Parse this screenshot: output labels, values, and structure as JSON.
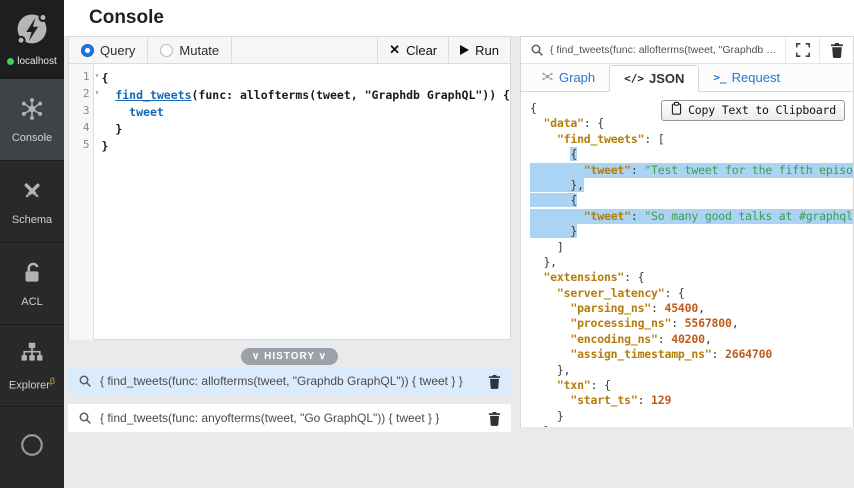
{
  "header": {
    "title": "Console"
  },
  "sidebar": {
    "connection": {
      "label": "localhost"
    },
    "items": [
      {
        "label": "Console"
      },
      {
        "label": "Schema"
      },
      {
        "label": "ACL"
      },
      {
        "label": "Explorer",
        "beta": "β"
      }
    ]
  },
  "editor_panel": {
    "tabs": {
      "query": "Query",
      "mutate": "Mutate"
    },
    "actions": {
      "clear": "Clear",
      "run": "Run"
    },
    "lines": [
      {
        "fold": true,
        "segs": [
          {
            "t": "{",
            "c": "p"
          }
        ]
      },
      {
        "fold": true,
        "segs": [
          {
            "t": "  ",
            "c": "p"
          },
          {
            "t": "find_tweets",
            "c": "kwu"
          },
          {
            "t": "(func: allofterms(tweet, \"Graphdb GraphQL\")) {",
            "c": "p"
          }
        ]
      },
      {
        "segs": [
          {
            "t": "    ",
            "c": "p"
          },
          {
            "t": "tweet",
            "c": "kw"
          }
        ]
      },
      {
        "segs": [
          {
            "t": "  }",
            "c": "p"
          }
        ]
      },
      {
        "segs": [
          {
            "t": "}",
            "c": "p"
          }
        ]
      }
    ]
  },
  "history": {
    "pill": "∨ HISTORY ∨",
    "items": [
      {
        "query": "{ find_tweets(func: allofterms(tweet, \"Graphdb GraphQL\")) { tweet } }"
      },
      {
        "query": "{ find_tweets(func: anyofterms(tweet, \"Go GraphQL\")) { tweet } }"
      }
    ]
  },
  "result_panel": {
    "query_preview": "{ find_tweets(func: allofterms(tweet, \"Graphdb GraphQL\")) { tweet } }",
    "tabs": [
      {
        "label": "Graph"
      },
      {
        "label": "JSON",
        "active": true
      },
      {
        "label": "Request"
      }
    ],
    "tab_glyphs": {
      "json": "</>",
      "request": ">_"
    },
    "copy_button": "Copy Text to Clipboard",
    "json_lines": [
      {
        "segs": [
          {
            "t": "{",
            "c": "p"
          }
        ]
      },
      {
        "segs": [
          {
            "t": "  ",
            "c": "p"
          },
          {
            "t": "\"data\"",
            "c": "k"
          },
          {
            "t": ": {",
            "c": "p"
          }
        ]
      },
      {
        "segs": [
          {
            "t": "    ",
            "c": "p"
          },
          {
            "t": "\"find_tweets\"",
            "c": "k"
          },
          {
            "t": ": [",
            "c": "p"
          }
        ]
      },
      {
        "segs": [
          {
            "t": "      ",
            "c": "p"
          },
          {
            "t": "{",
            "c": "p",
            "sel": true
          }
        ]
      },
      {
        "full_sel": true,
        "segs": [
          {
            "t": "        ",
            "c": "p"
          },
          {
            "t": "\"tweet\"",
            "c": "k"
          },
          {
            "t": ": ",
            "c": "p"
          },
          {
            "t": "\"Test tweet for the fifth episode of",
            "c": "s"
          }
        ]
      },
      {
        "segs": [
          {
            "t": "      },",
            "c": "p",
            "sel": true
          }
        ]
      },
      {
        "segs": [
          {
            "t": "      {",
            "c": "p",
            "sel": true
          }
        ]
      },
      {
        "full_sel": true,
        "segs": [
          {
            "t": "        ",
            "c": "p"
          },
          {
            "t": "\"tweet\"",
            "c": "k"
          },
          {
            "t": ": ",
            "c": "p"
          },
          {
            "t": "\"So many good talks at #graphqlconf,",
            "c": "s"
          }
        ]
      },
      {
        "segs": [
          {
            "t": "      }",
            "c": "p",
            "sel": true
          }
        ]
      },
      {
        "segs": [
          {
            "t": "    ]",
            "c": "p"
          }
        ]
      },
      {
        "segs": [
          {
            "t": "  },",
            "c": "p"
          }
        ]
      },
      {
        "segs": [
          {
            "t": "  ",
            "c": "p"
          },
          {
            "t": "\"extensions\"",
            "c": "k"
          },
          {
            "t": ": {",
            "c": "p"
          }
        ]
      },
      {
        "segs": [
          {
            "t": "    ",
            "c": "p"
          },
          {
            "t": "\"server_latency\"",
            "c": "k"
          },
          {
            "t": ": {",
            "c": "p"
          }
        ]
      },
      {
        "segs": [
          {
            "t": "      ",
            "c": "p"
          },
          {
            "t": "\"parsing_ns\"",
            "c": "k"
          },
          {
            "t": ": ",
            "c": "p"
          },
          {
            "t": "45400",
            "c": "n"
          },
          {
            "t": ",",
            "c": "p"
          }
        ]
      },
      {
        "segs": [
          {
            "t": "      ",
            "c": "p"
          },
          {
            "t": "\"processing_ns\"",
            "c": "k"
          },
          {
            "t": ": ",
            "c": "p"
          },
          {
            "t": "5567800",
            "c": "n"
          },
          {
            "t": ",",
            "c": "p"
          }
        ]
      },
      {
        "segs": [
          {
            "t": "      ",
            "c": "p"
          },
          {
            "t": "\"encoding_ns\"",
            "c": "k"
          },
          {
            "t": ": ",
            "c": "p"
          },
          {
            "t": "40200",
            "c": "n"
          },
          {
            "t": ",",
            "c": "p"
          }
        ]
      },
      {
        "segs": [
          {
            "t": "      ",
            "c": "p"
          },
          {
            "t": "\"assign_timestamp_ns\"",
            "c": "k"
          },
          {
            "t": ": ",
            "c": "p"
          },
          {
            "t": "2664700",
            "c": "n"
          }
        ]
      },
      {
        "segs": [
          {
            "t": "    },",
            "c": "p"
          }
        ]
      },
      {
        "segs": [
          {
            "t": "    ",
            "c": "p"
          },
          {
            "t": "\"txn\"",
            "c": "k"
          },
          {
            "t": ": {",
            "c": "p"
          }
        ]
      },
      {
        "segs": [
          {
            "t": "      ",
            "c": "p"
          },
          {
            "t": "\"start_ts\"",
            "c": "k"
          },
          {
            "t": ": ",
            "c": "p"
          },
          {
            "t": "129",
            "c": "n"
          }
        ]
      },
      {
        "segs": [
          {
            "t": "    }",
            "c": "p"
          }
        ]
      },
      {
        "segs": [
          {
            "t": "  }",
            "c": "p"
          }
        ]
      },
      {
        "segs": [
          {
            "t": "}",
            "c": "p"
          }
        ]
      }
    ]
  },
  "colors": {
    "accent_blue": "#2577d4",
    "selection": "#abd3f3",
    "json_key": "#b57d0b",
    "json_string": "#3f9e4f",
    "json_number": "#bf5b1d",
    "status_green": "#3fd158"
  }
}
